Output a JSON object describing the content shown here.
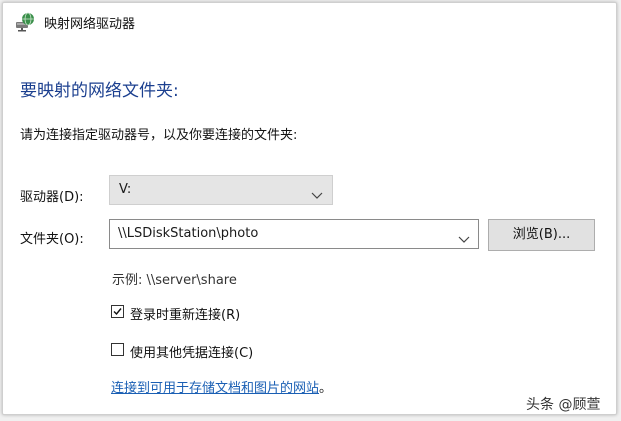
{
  "window": {
    "title": "映射网络驱动器",
    "icon": "network-drive-icon"
  },
  "main": {
    "heading": "要映射的网络文件夹:",
    "instruction": "请为连接指定驱动器号，以及你要连接的文件夹:"
  },
  "drive": {
    "label": "驱动器(D):",
    "value": "V:"
  },
  "folder": {
    "label": "文件夹(O):",
    "value": "\\\\LSDiskStation\\photo",
    "browse_label": "浏览(B)..."
  },
  "example": "示例: \\\\server\\share",
  "options": {
    "reconnect": {
      "label": "登录时重新连接(R)",
      "checked": true
    },
    "credentials": {
      "label": "使用其他凭据连接(C)",
      "checked": false
    }
  },
  "link": {
    "text": "连接到可用于存储文档和图片的网站",
    "tail": "。"
  },
  "watermark": "头条 @顾萱",
  "colors": {
    "heading": "#1b3f8f",
    "link": "#1a5fb4"
  }
}
